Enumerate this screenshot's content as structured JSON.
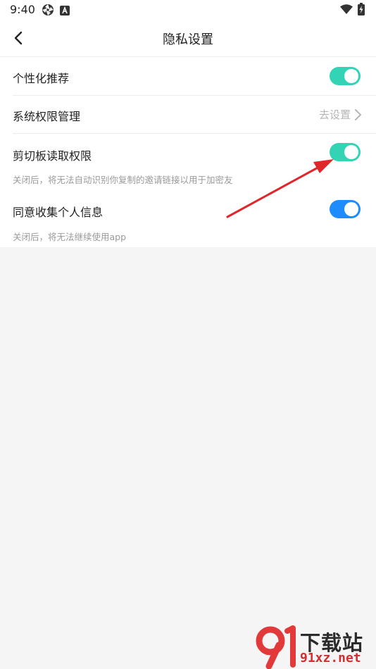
{
  "status_bar": {
    "time": "9:40"
  },
  "header": {
    "title": "隐私设置"
  },
  "settings": [
    {
      "label": "个性化推荐",
      "type": "toggle",
      "enabled": true,
      "color": "#33d3b6"
    },
    {
      "label": "系统权限管理",
      "type": "link",
      "action_label": "去设置"
    },
    {
      "label": "剪切板读取权限",
      "type": "toggle",
      "enabled": true,
      "color": "#33d3b6",
      "description": "关闭后，将无法自动识别你复制的邀请链接以用于加密友"
    },
    {
      "label": "同意收集个人信息",
      "type": "toggle",
      "enabled": true,
      "color": "#1e8cff",
      "description": "关闭后，将无法继续使用app"
    }
  ],
  "annotation": {
    "arrow_color": "#e0262b"
  },
  "watermark": {
    "brand": "下载站",
    "url": "91xz.net"
  }
}
